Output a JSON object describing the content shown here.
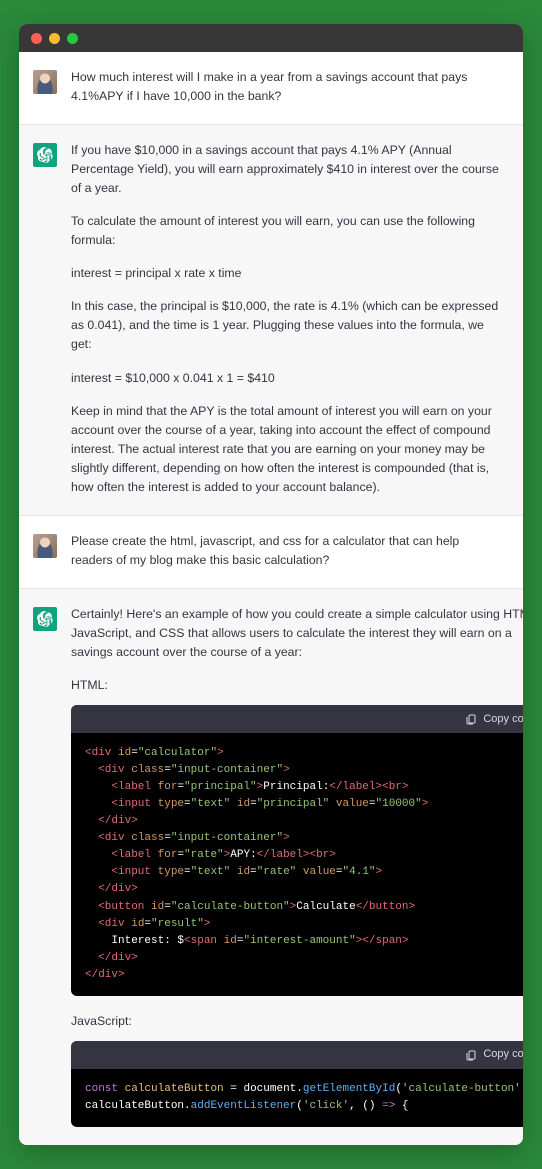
{
  "messages": {
    "m0": {
      "text": "How much interest will I make in a year from a savings account that pays 4.1%APY if I have 10,000 in the bank?"
    },
    "m1": {
      "p0": "If you have $10,000 in a savings account that pays 4.1% APY (Annual Percentage Yield), you will earn approximately $410 in interest over the course of a year.",
      "p1": "To calculate the amount of interest you will earn, you can use the following formula:",
      "p2": "interest = principal x rate x time",
      "p3": "In this case, the principal is $10,000, the rate is 4.1% (which can be expressed as 0.041), and the time is 1 year. Plugging these values into the formula, we get:",
      "p4": "interest = $10,000 x 0.041 x 1 = $410",
      "p5": "Keep in mind that the APY is the total amount of interest you will earn on your account over the course of a year, taking into account the effect of compound interest. The actual interest rate that you are earning on your money may be slightly different, depending on how often the interest is compounded (that is, how often the interest is added to your account balance)."
    },
    "m2": {
      "text": "Please create the html, javascript, and css for a calculator that can help readers of my blog make this basic calculation?"
    },
    "m3": {
      "p0": "Certainly! Here's an example of how you could create a simple calculator using HTML, JavaScript, and CSS that allows users to calculate the interest they will earn on a savings account over the course of a year:",
      "label_html": "HTML:",
      "label_js": "JavaScript:",
      "copy_label": "Copy code"
    }
  }
}
